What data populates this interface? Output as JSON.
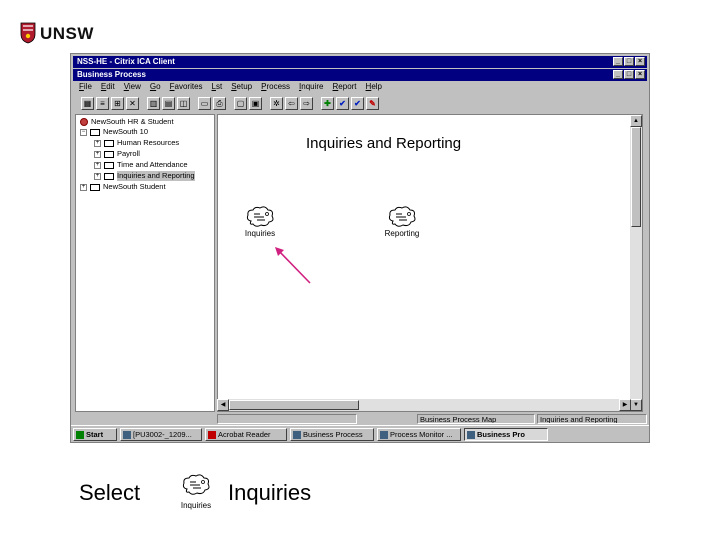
{
  "logo": {
    "text": "UNSW"
  },
  "window": {
    "app_title": "NSS-HE - Citrix ICA Client",
    "doc_title": "Business Process",
    "window_buttons": [
      "_",
      "□",
      "×"
    ]
  },
  "menu": [
    "File",
    "Edit",
    "View",
    "Go",
    "Favorites",
    "Lst",
    "Setup",
    "Process",
    "Inquire",
    "Report",
    "Help"
  ],
  "tree": {
    "items": [
      {
        "label": "NewSouth HR & Student",
        "expander": "",
        "icon": "root-icon"
      },
      {
        "label": "NewSouth 10",
        "expander": "−",
        "icon": "open-folder-icon"
      },
      {
        "label": "Human Resources",
        "expander": "+",
        "icon": "folder-icon"
      },
      {
        "label": "Payroll",
        "expander": "+",
        "icon": "folder-icon"
      },
      {
        "label": "Time and Attendance",
        "expander": "+",
        "icon": "folder-icon"
      },
      {
        "label": "Inquiries and Reporting",
        "expander": "+",
        "icon": "folder-icon"
      },
      {
        "label": "NewSouth Student",
        "expander": "+",
        "icon": "folder-icon"
      }
    ]
  },
  "map": {
    "title": "Inquiries and Reporting",
    "nodes": [
      {
        "label": "Inquiries",
        "icon": "process-cloud-icon"
      },
      {
        "label": "Reporting",
        "icon": "process-cloud-icon"
      }
    ],
    "arrow_color": "#d02080"
  },
  "status": {
    "panel_1": "",
    "panel_2": "Business Process Map",
    "panel_3": "Inquiries and Reporting"
  },
  "taskbar": {
    "start": "Start",
    "tasks": [
      "[PU3002-_1209...",
      "Acrobat Reader",
      "Business Process",
      "Process Monitor ...",
      "Business Pro"
    ]
  },
  "caption": {
    "select": "Select",
    "icon_label": "Inquiries",
    "target": "Inquiries"
  }
}
